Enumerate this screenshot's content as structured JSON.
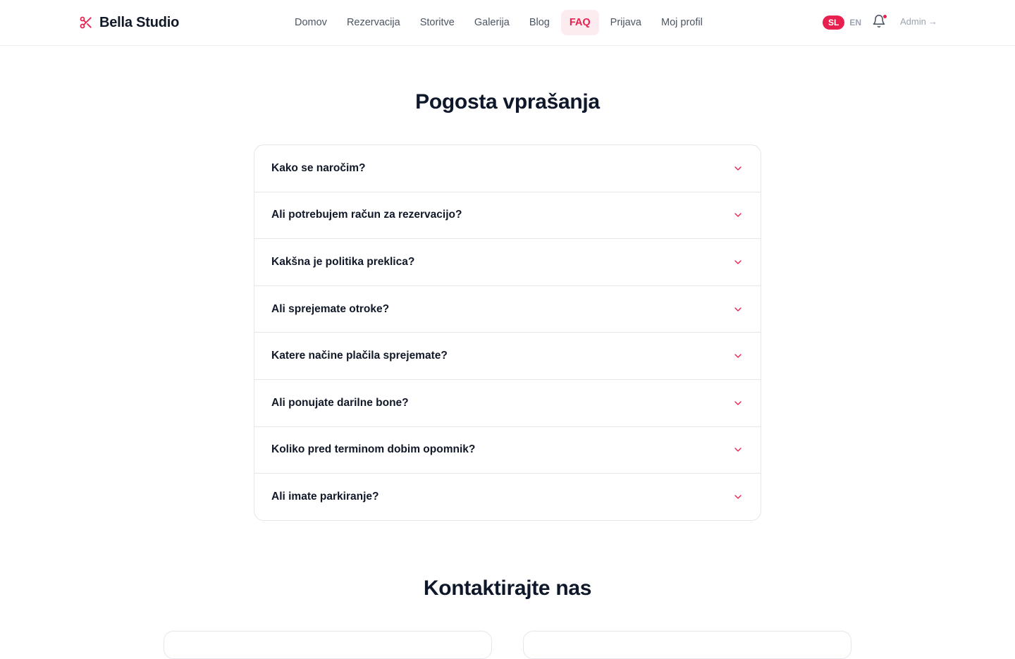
{
  "brand": {
    "name": "Bella Studio",
    "accent": "#e8204f"
  },
  "nav": {
    "items": [
      {
        "label": "Domov",
        "active": false
      },
      {
        "label": "Rezervacija",
        "active": false
      },
      {
        "label": "Storitve",
        "active": false
      },
      {
        "label": "Galerija",
        "active": false
      },
      {
        "label": "Blog",
        "active": false
      },
      {
        "label": "FAQ",
        "active": true
      },
      {
        "label": "Prijava",
        "active": false
      },
      {
        "label": "Moj profil",
        "active": false
      }
    ]
  },
  "lang": {
    "current": "SL",
    "other": "EN"
  },
  "notifications": {
    "icon": "bell-icon",
    "has_unread": true
  },
  "admin": {
    "label": "Admin",
    "arrow": "→"
  },
  "faq": {
    "title": "Pogosta vprašanja",
    "questions": [
      "Kako se naročim?",
      "Ali potrebujem račun za rezervacijo?",
      "Kakšna je politika preklica?",
      "Ali sprejemate otroke?",
      "Katere načine plačila sprejemate?",
      "Ali ponujate darilne bone?",
      "Koliko pred terminom dobim opomnik?",
      "Ali imate parkiranje?"
    ]
  },
  "contact": {
    "title": "Kontaktirajte nas"
  }
}
